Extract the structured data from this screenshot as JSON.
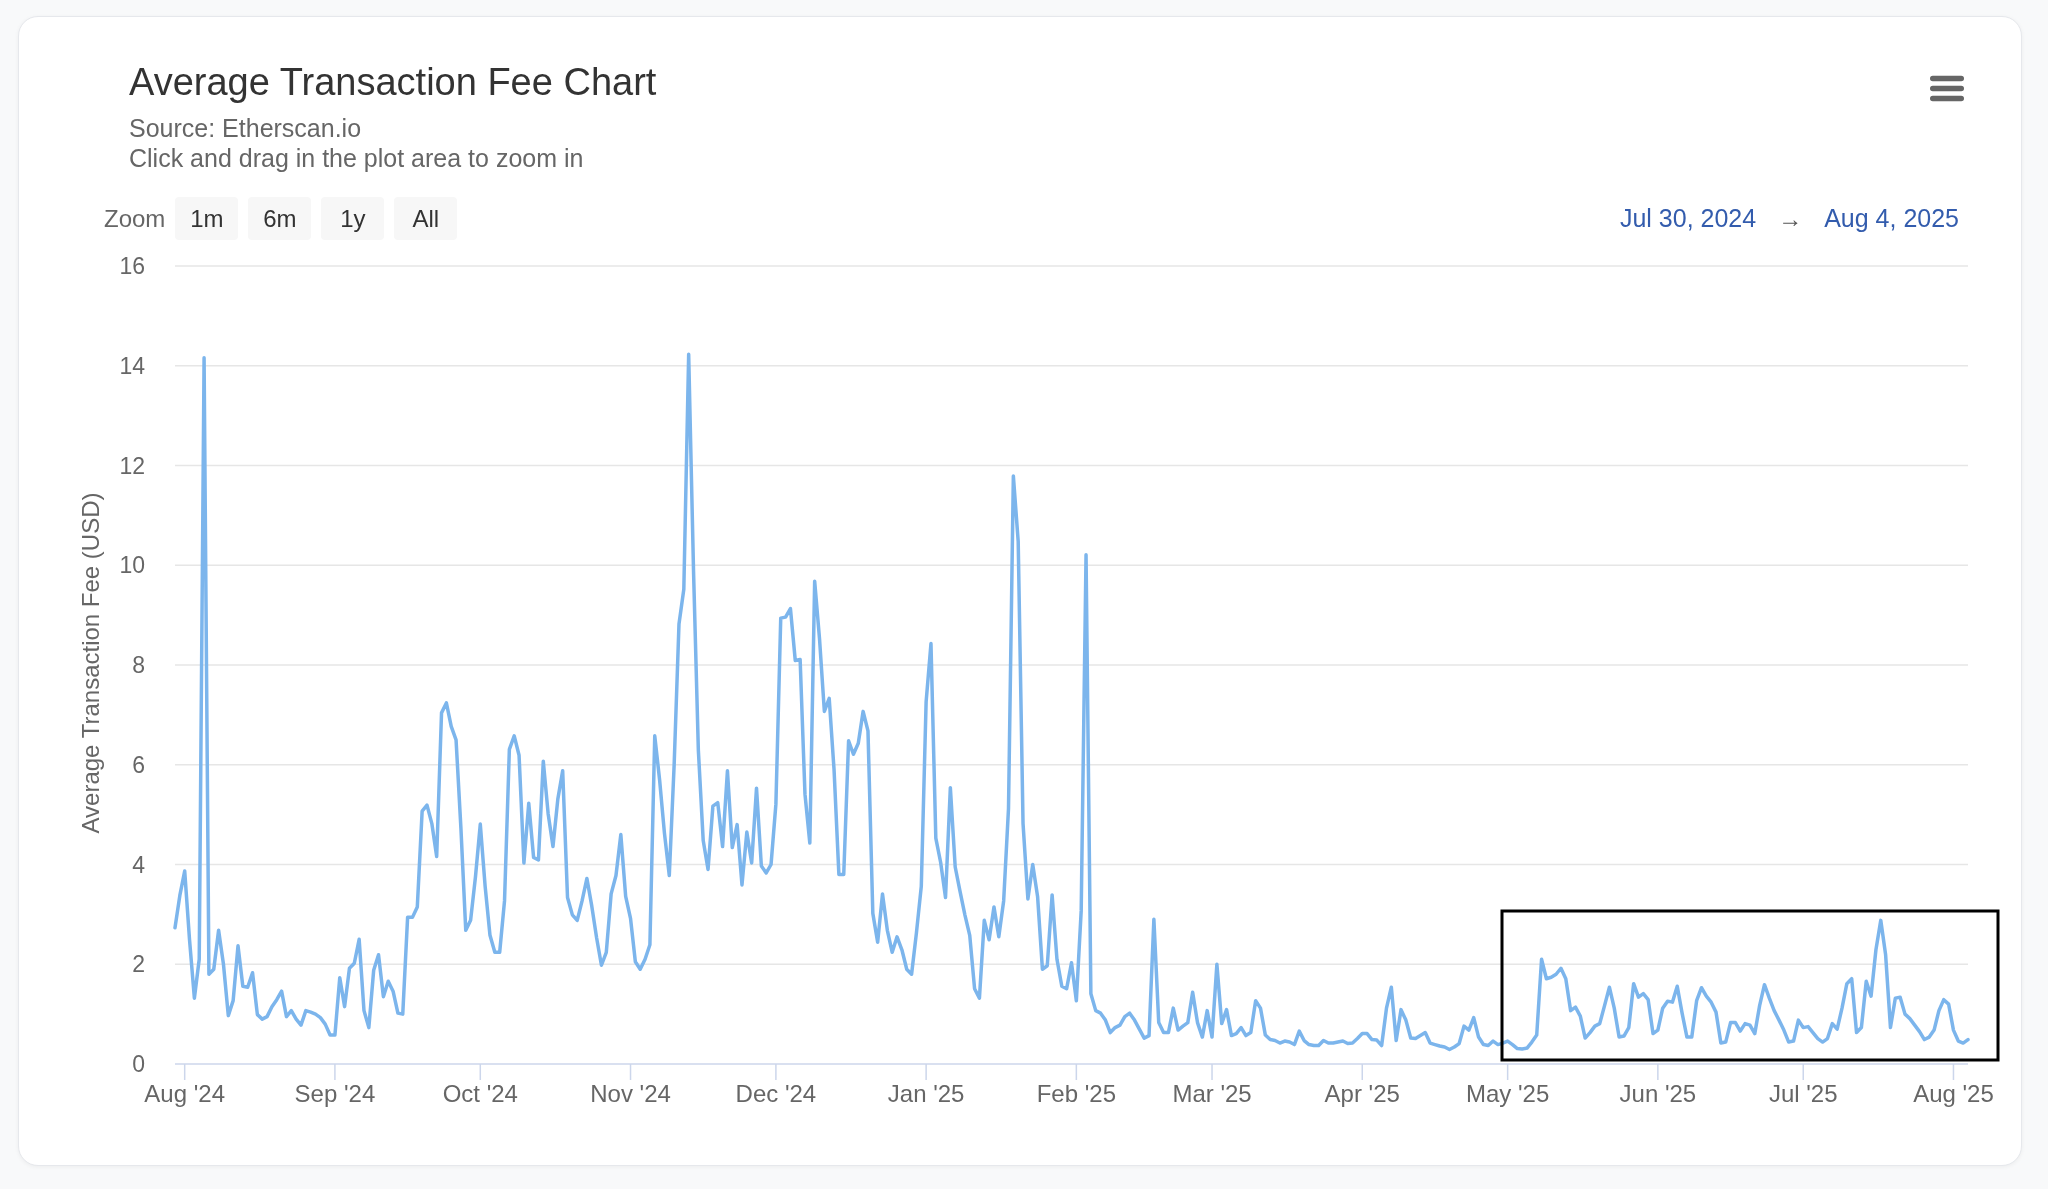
{
  "title": "Average Transaction Fee Chart",
  "subtitle": [
    "Source: Etherscan.io",
    "Click and drag in the plot area to zoom in"
  ],
  "zoom": {
    "label": "Zoom",
    "buttons": [
      {
        "label": "1m",
        "selected": false
      },
      {
        "label": "6m",
        "selected": false
      },
      {
        "label": "1y",
        "selected": false
      },
      {
        "label": "All",
        "selected": false
      }
    ]
  },
  "date_range": {
    "from": "Jul 30, 2024",
    "separator": "→",
    "to": "Aug 4, 2025"
  },
  "chart": {
    "highlight_box": {
      "visible": true
    },
    "chart_data": {
      "type": "line",
      "ylabel": "Average Transaction Fee (USD)",
      "x": [
        "2024-07-30",
        "2024-07-31",
        "2024-08-01",
        "2024-08-02",
        "2024-08-03",
        "2024-08-04",
        "2024-08-05",
        "2024-08-06",
        "2024-08-07",
        "2024-08-08",
        "2024-08-09",
        "2024-08-10",
        "2024-08-11",
        "2024-08-12",
        "2024-08-13",
        "2024-08-14",
        "2024-08-15",
        "2024-08-16",
        "2024-08-17",
        "2024-08-18",
        "2024-08-19",
        "2024-08-20",
        "2024-08-21",
        "2024-08-22",
        "2024-08-23",
        "2024-08-24",
        "2024-08-25",
        "2024-08-26",
        "2024-08-27",
        "2024-08-28",
        "2024-08-29",
        "2024-08-30",
        "2024-08-31",
        "2024-09-01",
        "2024-09-02",
        "2024-09-03",
        "2024-09-04",
        "2024-09-05",
        "2024-09-06",
        "2024-09-07",
        "2024-09-08",
        "2024-09-09",
        "2024-09-10",
        "2024-09-11",
        "2024-09-12",
        "2024-09-13",
        "2024-09-14",
        "2024-09-15",
        "2024-09-16",
        "2024-09-17",
        "2024-09-18",
        "2024-09-19",
        "2024-09-20",
        "2024-09-21",
        "2024-09-22",
        "2024-09-23",
        "2024-09-24",
        "2024-09-25",
        "2024-09-26",
        "2024-09-27",
        "2024-09-28",
        "2024-09-29",
        "2024-09-30",
        "2024-10-01",
        "2024-10-02",
        "2024-10-03",
        "2024-10-04",
        "2024-10-05",
        "2024-10-06",
        "2024-10-07",
        "2024-10-08",
        "2024-10-09",
        "2024-10-10",
        "2024-10-11",
        "2024-10-12",
        "2024-10-13",
        "2024-10-14",
        "2024-10-15",
        "2024-10-16",
        "2024-10-17",
        "2024-10-18",
        "2024-10-19",
        "2024-10-20",
        "2024-10-21",
        "2024-10-22",
        "2024-10-23",
        "2024-10-24",
        "2024-10-25",
        "2024-10-26",
        "2024-10-27",
        "2024-10-28",
        "2024-10-29",
        "2024-10-30",
        "2024-10-31",
        "2024-11-01",
        "2024-11-02",
        "2024-11-03",
        "2024-11-04",
        "2024-11-05",
        "2024-11-06",
        "2024-11-07",
        "2024-11-08",
        "2024-11-09",
        "2024-11-10",
        "2024-11-11",
        "2024-11-12",
        "2024-11-13",
        "2024-11-14",
        "2024-11-15",
        "2024-11-16",
        "2024-11-17",
        "2024-11-18",
        "2024-11-19",
        "2024-11-20",
        "2024-11-21",
        "2024-11-22",
        "2024-11-23",
        "2024-11-24",
        "2024-11-25",
        "2024-11-26",
        "2024-11-27",
        "2024-11-28",
        "2024-11-29",
        "2024-11-30",
        "2024-12-01",
        "2024-12-02",
        "2024-12-03",
        "2024-12-04",
        "2024-12-05",
        "2024-12-06",
        "2024-12-07",
        "2024-12-08",
        "2024-12-09",
        "2024-12-10",
        "2024-12-11",
        "2024-12-12",
        "2024-12-13",
        "2024-12-14",
        "2024-12-15",
        "2024-12-16",
        "2024-12-17",
        "2024-12-18",
        "2024-12-19",
        "2024-12-20",
        "2024-12-21",
        "2024-12-22",
        "2024-12-23",
        "2024-12-24",
        "2024-12-25",
        "2024-12-26",
        "2024-12-27",
        "2024-12-28",
        "2024-12-29",
        "2024-12-30",
        "2024-12-31",
        "2025-01-01",
        "2025-01-02",
        "2025-01-03",
        "2025-01-04",
        "2025-01-05",
        "2025-01-06",
        "2025-01-07",
        "2025-01-08",
        "2025-01-09",
        "2025-01-10",
        "2025-01-11",
        "2025-01-12",
        "2025-01-13",
        "2025-01-14",
        "2025-01-15",
        "2025-01-16",
        "2025-01-17",
        "2025-01-18",
        "2025-01-19",
        "2025-01-20",
        "2025-01-21",
        "2025-01-22",
        "2025-01-23",
        "2025-01-24",
        "2025-01-25",
        "2025-01-26",
        "2025-01-27",
        "2025-01-28",
        "2025-01-29",
        "2025-01-30",
        "2025-01-31",
        "2025-02-01",
        "2025-02-02",
        "2025-02-03",
        "2025-02-04",
        "2025-02-05",
        "2025-02-06",
        "2025-02-07",
        "2025-02-08",
        "2025-02-09",
        "2025-02-10",
        "2025-02-11",
        "2025-02-12",
        "2025-02-13",
        "2025-02-14",
        "2025-02-15",
        "2025-02-16",
        "2025-02-17",
        "2025-02-18",
        "2025-02-19",
        "2025-02-20",
        "2025-02-21",
        "2025-02-22",
        "2025-02-23",
        "2025-02-24",
        "2025-02-25",
        "2025-02-26",
        "2025-02-27",
        "2025-02-28",
        "2025-03-01",
        "2025-03-02",
        "2025-03-03",
        "2025-03-04",
        "2025-03-05",
        "2025-03-06",
        "2025-03-07",
        "2025-03-08",
        "2025-03-09",
        "2025-03-10",
        "2025-03-11",
        "2025-03-12",
        "2025-03-13",
        "2025-03-14",
        "2025-03-15",
        "2025-03-16",
        "2025-03-17",
        "2025-03-18",
        "2025-03-19",
        "2025-03-20",
        "2025-03-21",
        "2025-03-22",
        "2025-03-23",
        "2025-03-24",
        "2025-03-25",
        "2025-03-26",
        "2025-03-27",
        "2025-03-28",
        "2025-03-29",
        "2025-03-30",
        "2025-03-31",
        "2025-04-01",
        "2025-04-02",
        "2025-04-03",
        "2025-04-04",
        "2025-04-05",
        "2025-04-06",
        "2025-04-07",
        "2025-04-08",
        "2025-04-09",
        "2025-04-10",
        "2025-04-11",
        "2025-04-12",
        "2025-04-13",
        "2025-04-14",
        "2025-04-15",
        "2025-04-16",
        "2025-04-17",
        "2025-04-18",
        "2025-04-19",
        "2025-04-20",
        "2025-04-21",
        "2025-04-22",
        "2025-04-23",
        "2025-04-24",
        "2025-04-25",
        "2025-04-26",
        "2025-04-27",
        "2025-04-28",
        "2025-04-29",
        "2025-04-30",
        "2025-05-01",
        "2025-05-02",
        "2025-05-03",
        "2025-05-04",
        "2025-05-05",
        "2025-05-06",
        "2025-05-07",
        "2025-05-08",
        "2025-05-09",
        "2025-05-10",
        "2025-05-11",
        "2025-05-12",
        "2025-05-13",
        "2025-05-14",
        "2025-05-15",
        "2025-05-16",
        "2025-05-17",
        "2025-05-18",
        "2025-05-19",
        "2025-05-20",
        "2025-05-21",
        "2025-05-22",
        "2025-05-23",
        "2025-05-24",
        "2025-05-25",
        "2025-05-26",
        "2025-05-27",
        "2025-05-28",
        "2025-05-29",
        "2025-05-30",
        "2025-05-31",
        "2025-06-01",
        "2025-06-02",
        "2025-06-03",
        "2025-06-04",
        "2025-06-05",
        "2025-06-06",
        "2025-06-07",
        "2025-06-08",
        "2025-06-09",
        "2025-06-10",
        "2025-06-11",
        "2025-06-12",
        "2025-06-13",
        "2025-06-14",
        "2025-06-15",
        "2025-06-16",
        "2025-06-17",
        "2025-06-18",
        "2025-06-19",
        "2025-06-20",
        "2025-06-21",
        "2025-06-22",
        "2025-06-23",
        "2025-06-24",
        "2025-06-25",
        "2025-06-26",
        "2025-06-27",
        "2025-06-28",
        "2025-06-29",
        "2025-06-30",
        "2025-07-01",
        "2025-07-02",
        "2025-07-03",
        "2025-07-04",
        "2025-07-05",
        "2025-07-06",
        "2025-07-07",
        "2025-07-08",
        "2025-07-09",
        "2025-07-10",
        "2025-07-11",
        "2025-07-12",
        "2025-07-13",
        "2025-07-14",
        "2025-07-15",
        "2025-07-16",
        "2025-07-17",
        "2025-07-18",
        "2025-07-19",
        "2025-07-20",
        "2025-07-21",
        "2025-07-22",
        "2025-07-23",
        "2025-07-24",
        "2025-07-25",
        "2025-07-26",
        "2025-07-27",
        "2025-07-28",
        "2025-07-29",
        "2025-07-30",
        "2025-07-31",
        "2025-08-01",
        "2025-08-02",
        "2025-08-03",
        "2025-08-04"
      ],
      "series": [
        {
          "color": "#7cb5ec",
          "values": [
            2.73,
            3.38,
            3.87,
            2.49,
            1.32,
            2.1,
            14.16,
            1.8,
            1.9,
            2.68,
            2.0,
            0.97,
            1.27,
            2.37,
            1.56,
            1.54,
            1.83,
            0.99,
            0.9,
            0.95,
            1.15,
            1.29,
            1.46,
            0.95,
            1.07,
            0.9,
            0.78,
            1.07,
            1.04,
            1.0,
            0.93,
            0.8,
            0.58,
            0.58,
            1.73,
            1.15,
            1.92,
            2.02,
            2.5,
            1.07,
            0.73,
            1.88,
            2.19,
            1.35,
            1.66,
            1.46,
            1.02,
            1.0,
            2.94,
            2.94,
            3.15,
            5.07,
            5.19,
            4.82,
            4.16,
            7.04,
            7.24,
            6.77,
            6.5,
            4.73,
            2.68,
            2.88,
            3.75,
            4.81,
            3.56,
            2.58,
            2.24,
            2.24,
            3.27,
            6.31,
            6.58,
            6.19,
            4.03,
            5.23,
            4.14,
            4.09,
            6.07,
            5.02,
            4.36,
            5.31,
            5.88,
            3.34,
            2.99,
            2.88,
            3.27,
            3.72,
            3.17,
            2.53,
            1.98,
            2.24,
            3.41,
            3.78,
            4.6,
            3.36,
            2.92,
            2.05,
            1.9,
            2.1,
            2.39,
            6.58,
            5.7,
            4.63,
            3.78,
            5.99,
            8.82,
            9.52,
            14.23,
            9.89,
            6.29,
            4.48,
            3.9,
            5.17,
            5.24,
            4.36,
            5.88,
            4.34,
            4.8,
            3.59,
            4.65,
            4.03,
            5.53,
            3.97,
            3.83,
            4.0,
            5.21,
            8.94,
            8.96,
            9.13,
            8.09,
            8.11,
            5.41,
            4.43,
            9.68,
            8.53,
            7.07,
            7.33,
            5.9,
            3.8,
            3.8,
            6.48,
            6.21,
            6.43,
            7.07,
            6.68,
            3.02,
            2.44,
            3.41,
            2.68,
            2.24,
            2.55,
            2.29,
            1.9,
            1.8,
            2.63,
            3.56,
            7.26,
            8.43,
            4.53,
            4.04,
            3.34,
            5.54,
            3.95,
            3.46,
            2.99,
            2.58,
            1.51,
            1.32,
            2.88,
            2.49,
            3.15,
            2.55,
            3.27,
            5.12,
            11.79,
            10.48,
            4.82,
            3.31,
            4.0,
            3.36,
            1.9,
            1.97,
            3.39,
            2.1,
            1.56,
            1.51,
            2.03,
            1.27,
            3.07,
            10.21,
            1.41,
            1.07,
            1.02,
            0.88,
            0.63,
            0.73,
            0.78,
            0.95,
            1.02,
            0.88,
            0.7,
            0.52,
            0.57,
            2.9,
            0.83,
            0.63,
            0.63,
            1.12,
            0.68,
            0.76,
            0.83,
            1.44,
            0.83,
            0.54,
            1.07,
            0.54,
            2.0,
            0.81,
            1.09,
            0.57,
            0.61,
            0.73,
            0.57,
            0.63,
            1.27,
            1.12,
            0.58,
            0.49,
            0.47,
            0.42,
            0.46,
            0.44,
            0.39,
            0.66,
            0.47,
            0.39,
            0.37,
            0.37,
            0.47,
            0.42,
            0.42,
            0.44,
            0.46,
            0.41,
            0.42,
            0.51,
            0.61,
            0.61,
            0.49,
            0.48,
            0.37,
            1.12,
            1.54,
            0.47,
            1.09,
            0.88,
            0.52,
            0.51,
            0.57,
            0.63,
            0.42,
            0.39,
            0.36,
            0.34,
            0.29,
            0.34,
            0.41,
            0.76,
            0.68,
            0.93,
            0.54,
            0.39,
            0.37,
            0.46,
            0.39,
            0.42,
            0.46,
            0.39,
            0.31,
            0.3,
            0.32,
            0.44,
            0.58,
            2.1,
            1.71,
            1.74,
            1.8,
            1.92,
            1.71,
            1.07,
            1.14,
            0.96,
            0.52,
            0.63,
            0.76,
            0.81,
            1.17,
            1.54,
            1.12,
            0.54,
            0.56,
            0.73,
            1.61,
            1.34,
            1.41,
            1.29,
            0.61,
            0.68,
            1.12,
            1.26,
            1.24,
            1.56,
            1.02,
            0.54,
            0.54,
            1.27,
            1.53,
            1.36,
            1.24,
            1.04,
            0.42,
            0.44,
            0.83,
            0.83,
            0.66,
            0.81,
            0.78,
            0.61,
            1.17,
            1.59,
            1.32,
            1.07,
            0.88,
            0.68,
            0.44,
            0.46,
            0.88,
            0.73,
            0.75,
            0.63,
            0.51,
            0.44,
            0.51,
            0.81,
            0.7,
            1.12,
            1.61,
            1.71,
            0.63,
            0.73,
            1.66,
            1.36,
            2.29,
            2.88,
            2.19,
            0.73,
            1.32,
            1.34,
            1.0,
            0.91,
            0.78,
            0.65,
            0.49,
            0.54,
            0.68,
            1.07,
            1.29,
            1.2,
            0.68,
            0.46,
            0.42,
            0.49
          ]
        }
      ],
      "xlim": [
        "2024-07-30",
        "2025-08-04"
      ],
      "ylim": [
        0,
        16
      ],
      "yticks": [
        0,
        2,
        4,
        6,
        8,
        10,
        12,
        14,
        16
      ],
      "grid": true,
      "xticks": [
        {
          "value": "2024-08-01",
          "label": "Aug '24"
        },
        {
          "value": "2024-09-01",
          "label": "Sep '24"
        },
        {
          "value": "2024-10-01",
          "label": "Oct '24"
        },
        {
          "value": "2024-11-01",
          "label": "Nov '24"
        },
        {
          "value": "2024-12-01",
          "label": "Dec '24"
        },
        {
          "value": "2025-01-01",
          "label": "Jan '25"
        },
        {
          "value": "2025-02-01",
          "label": "Feb '25"
        },
        {
          "value": "2025-03-01",
          "label": "Mar '25"
        },
        {
          "value": "2025-04-01",
          "label": "Apr '25"
        },
        {
          "value": "2025-05-01",
          "label": "May '25"
        },
        {
          "value": "2025-06-01",
          "label": "Jun '25"
        },
        {
          "value": "2025-07-01",
          "label": "Jul '25"
        },
        {
          "value": "2025-08-01",
          "label": "Aug '25"
        }
      ]
    }
  }
}
